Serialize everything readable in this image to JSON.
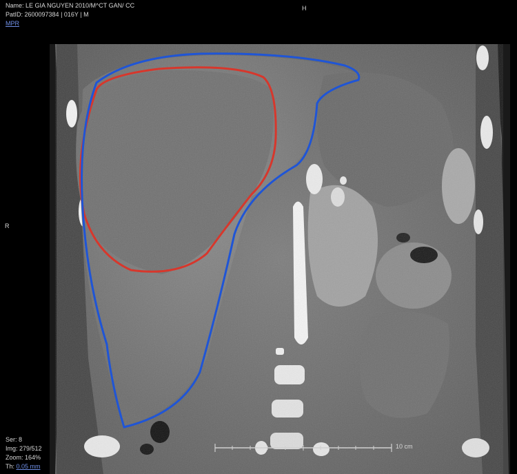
{
  "header": {
    "name_line": "Name: LE GIA NGUYEN 2010/M^CT GAN/ CC",
    "patient_line": "PatID: 2600097384 | 016Y | M",
    "mode_link": "MPR"
  },
  "orientation": {
    "top": "H",
    "left": "R"
  },
  "footer": {
    "series": "Ser: 8",
    "image": "Img: 279/512",
    "zoom": "Zoom: 164%",
    "thickness_label": "Th: ",
    "thickness_value": "0.05 mm"
  },
  "scale_bar": {
    "label": "10 cm"
  },
  "annotations": {
    "red_color": "#d7372c",
    "blue_color": "#1f55d6"
  }
}
